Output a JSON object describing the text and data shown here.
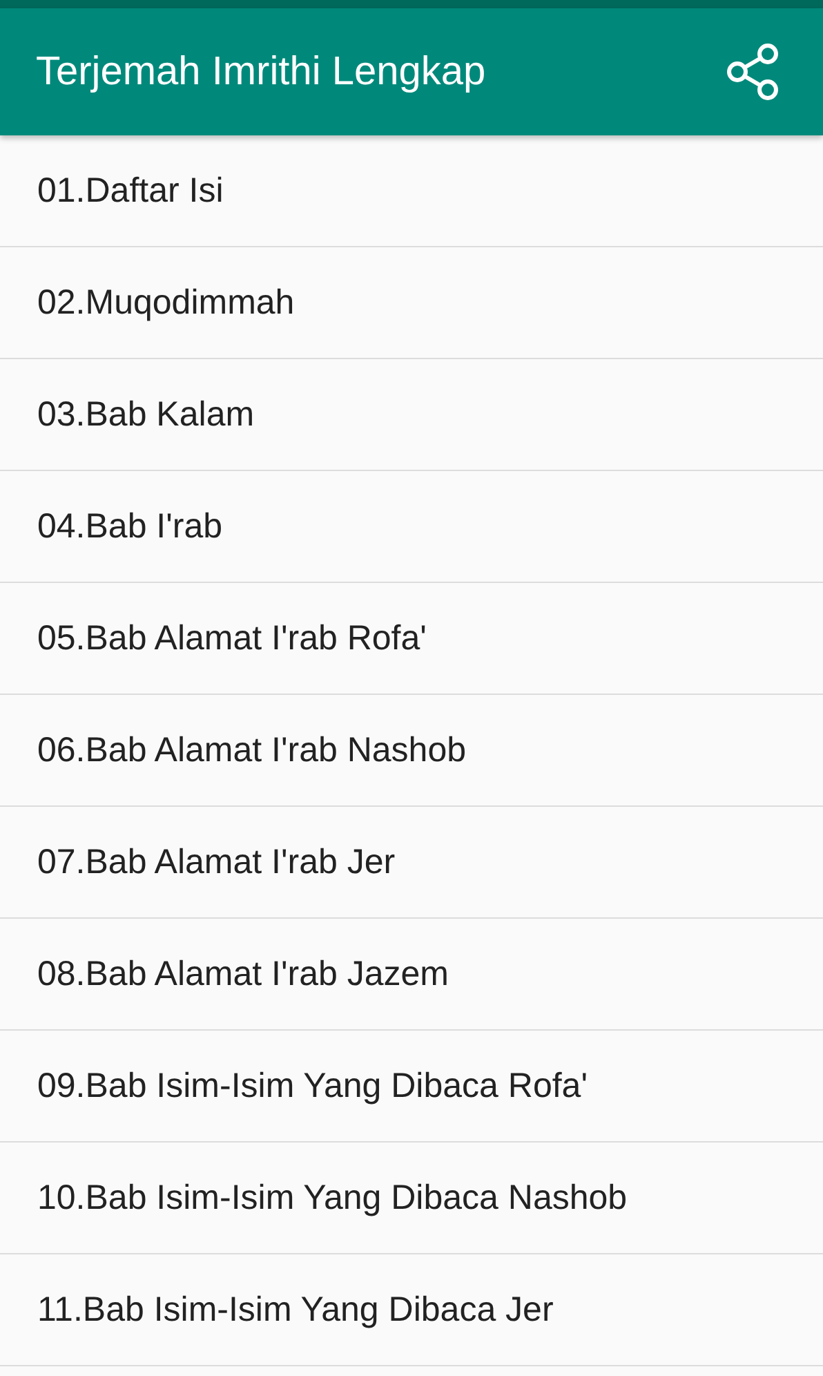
{
  "app_bar": {
    "title": "Terjemah Imrithi Lengkap"
  },
  "chapters": [
    {
      "label": "01.Daftar Isi"
    },
    {
      "label": "02.Muqodimmah"
    },
    {
      "label": "03.Bab Kalam"
    },
    {
      "label": "04.Bab I'rab"
    },
    {
      "label": "05.Bab Alamat I'rab Rofa'"
    },
    {
      "label": "06.Bab Alamat I'rab Nashob"
    },
    {
      "label": "07.Bab Alamat I'rab Jer"
    },
    {
      "label": "08.Bab Alamat I'rab Jazem"
    },
    {
      "label": "09.Bab Isim-Isim Yang Dibaca Rofa'"
    },
    {
      "label": "10.Bab Isim-Isim Yang Dibaca Nashob"
    },
    {
      "label": "11.Bab Isim-Isim Yang Dibaca Jer"
    }
  ]
}
